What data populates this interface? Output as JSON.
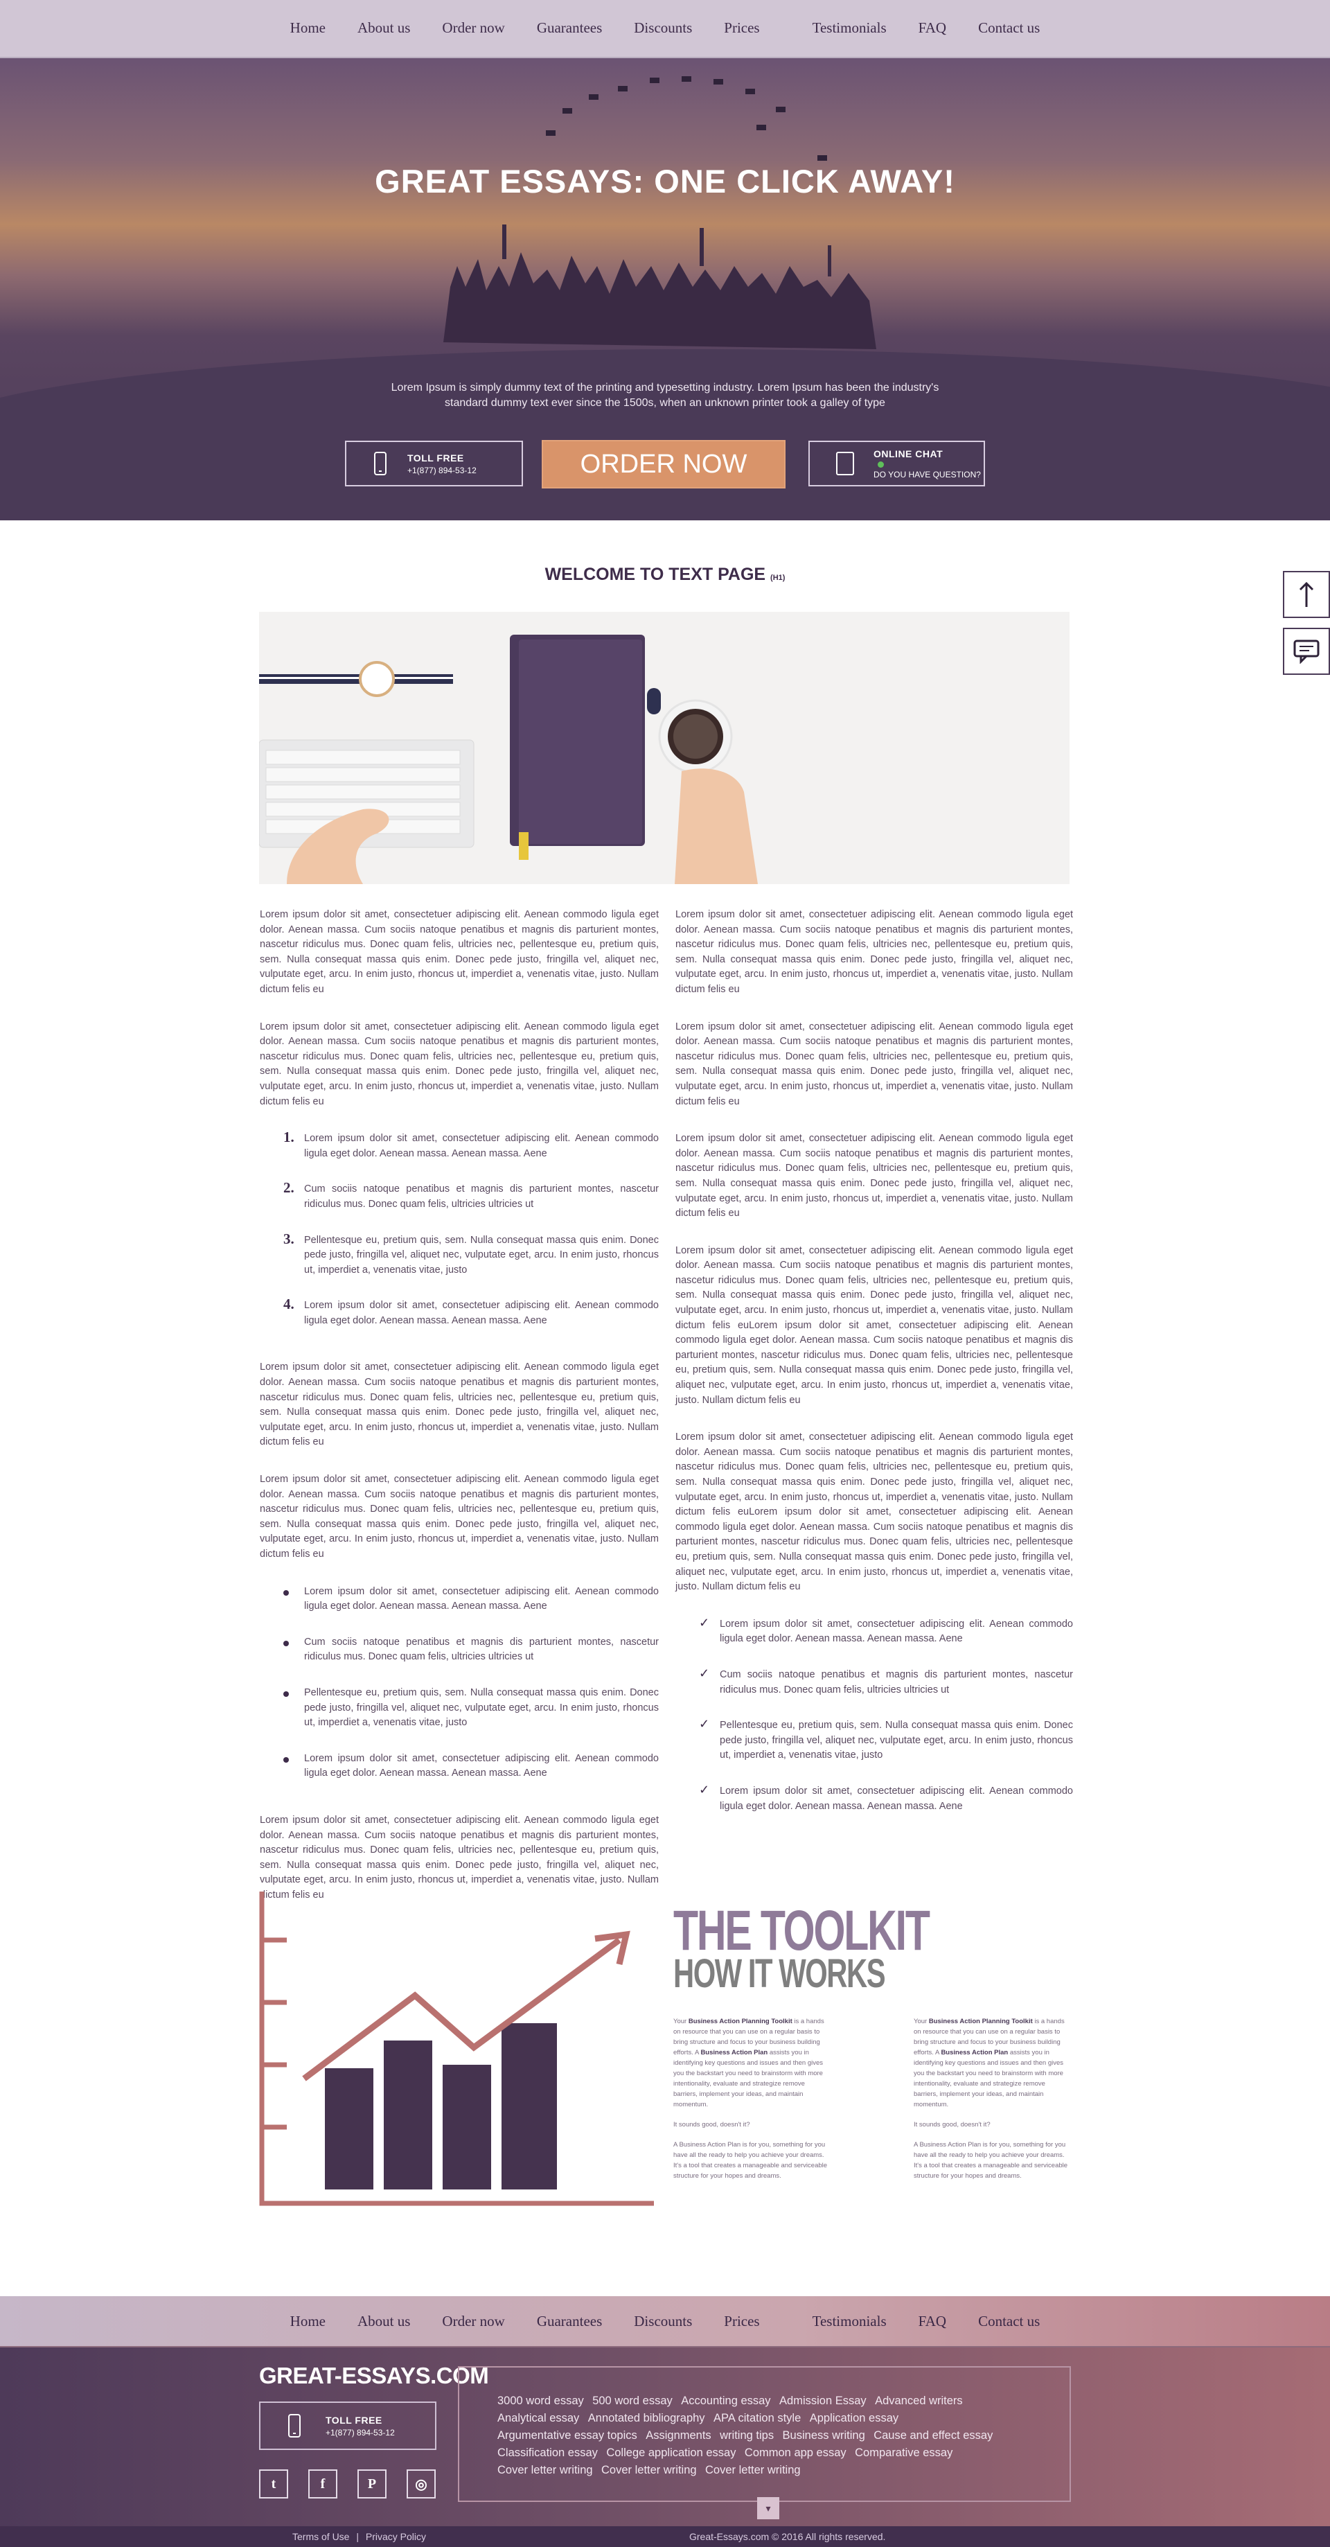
{
  "nav": [
    "Home",
    "About us",
    "Order now",
    "Guarantees",
    "Discounts",
    "Prices",
    "Testimonials",
    "FAQ",
    "Contact us"
  ],
  "hero": {
    "title": "GREAT ESSAYS: ONE CLICK AWAY!",
    "description": "Lorem Ipsum is simply dummy text of the printing and typesetting industry. Lorem Ipsum has been the industry's standard dummy text ever since the 1500s, when an unknown printer took a galley of type",
    "toll_label": "TOLL FREE",
    "toll_number": "+1(877) 894-53-12",
    "order_button": "ORDER NOW",
    "chat_label": "ONLINE CHAT",
    "chat_sub": "DO YOU HAVE QUESTION?"
  },
  "page": {
    "title": "WELCOME TO TEXT PAGE",
    "title_tag": "(H1)"
  },
  "content": {
    "paragraph": "Lorem ipsum dolor sit amet, consectetuer adipiscing elit. Aenean commodo ligula eget dolor. Aenean massa. Cum sociis natoque penatibus et magnis dis parturient montes, nascetur ridiculus mus. Donec quam felis, ultricies nec, pellentesque eu, pretium quis, sem. Nulla consequat massa quis enim. Donec pede justo, fringilla vel, aliquet nec, vulputate eget, arcu. In enim justo, rhoncus ut, imperdiet a, venenatis vitae, justo. Nullam dictum felis eu",
    "long_paragraph": "Lorem ipsum dolor sit amet, consectetuer adipiscing elit. Aenean commodo ligula eget dolor. Aenean massa. Cum sociis natoque penatibus et magnis dis parturient montes, nascetur ridiculus mus. Donec quam felis, ultricies nec, pellentesque eu, pretium quis, sem. Nulla consequat massa quis enim. Donec pede justo, fringilla vel, aliquet nec, vulputate eget, arcu. In enim justo, rhoncus ut, imperdiet a, venenatis vitae, justo. Nullam dictum felis euLorem ipsum dolor sit amet, consectetuer adipiscing elit. Aenean commodo ligula eget dolor. Aenean massa. Cum sociis natoque penatibus et magnis dis parturient montes, nascetur ridiculus mus. Donec quam felis, ultricies nec, pellentesque eu, pretium quis, sem. Nulla consequat massa quis enim. Donec pede justo, fringilla vel, aliquet nec, vulputate eget, arcu. In enim justo, rhoncus ut, imperdiet a, venenatis vitae, justo. Nullam dictum felis eu",
    "list_items": [
      "Lorem ipsum dolor sit amet, consectetuer adipiscing elit. Aenean commodo ligula eget dolor. Aenean massa. Aenean massa. Aene",
      "Cum sociis natoque penatibus et magnis dis parturient montes, nascetur ridiculus mus. Donec quam felis, ultricies ultricies ut",
      "Pellentesque eu, pretium quis, sem. Nulla consequat massa quis enim. Donec pede justo, fringilla vel, aliquet nec, vulputate eget, arcu. In enim justo, rhoncus ut, imperdiet a, venenatis vitae, justo",
      "Lorem ipsum dolor sit amet, consectetuer adipiscing elit. Aenean commodo ligula eget dolor. Aenean massa. Aenean massa. Aene"
    ],
    "ordered_numbers": [
      "1.",
      "2.",
      "3.",
      "4."
    ]
  },
  "toolkit": {
    "title": "THE TOOLKIT",
    "subtitle": "HOW IT WORKS",
    "intro_a": "Your ",
    "brand": "Business Action Planning Toolkit",
    "intro_b": " is a hands on resource that you can use on a regular basis to bring structure and focus to your business building efforts. A ",
    "plan": "Business Action Plan",
    "intro_c": " assists you in identifying key questions and issues and then gives you the backstart you need to brainstorm with more intentionality, evaluate and strategize remove barriers, implement your ideas, and maintain momentum.",
    "question": "It sounds good, doesn't it?",
    "closing": "A Business Action Plan is for you, something for you have all the ready to help you achieve your dreams. It's a tool that creates a manageable and serviceable structure for your hopes and dreams."
  },
  "footer": {
    "logo": "GREAT-ESSAYS.COM",
    "toll_label": "TOLL FREE",
    "toll_number": "+1(877) 894-53-12",
    "social": [
      {
        "icon": "twitter-icon",
        "glyph": "t"
      },
      {
        "icon": "facebook-icon",
        "glyph": "f"
      },
      {
        "icon": "pinterest-icon",
        "glyph": "P"
      },
      {
        "icon": "instagram-icon",
        "glyph": "◎"
      }
    ],
    "links": [
      "3000 word essay",
      "500 word essay",
      "Accounting essay",
      "Admission Essay",
      "Advanced writers",
      "Analytical essay",
      "Annotated bibliography",
      "APA citation style",
      "Application essay",
      "Argumentative essay topics",
      "Assignments",
      "writing tips",
      "Business writing",
      "Cause and effect essay",
      "Classification essay",
      "College application essay",
      "Common app essay",
      "Comparative essay",
      "Cover letter writing",
      "Cover letter writing",
      "Cover letter writing"
    ],
    "expand_glyph": "▾",
    "terms": "Terms of Use",
    "separator": "|",
    "privacy": "Privacy Policy",
    "copyright": "Great-Essays.com © 2016 All rights reserved."
  },
  "colors": {
    "accent_orange": "#d9946a",
    "brand_purple": "#4a3a57",
    "chart_rose": "#b9716f"
  }
}
